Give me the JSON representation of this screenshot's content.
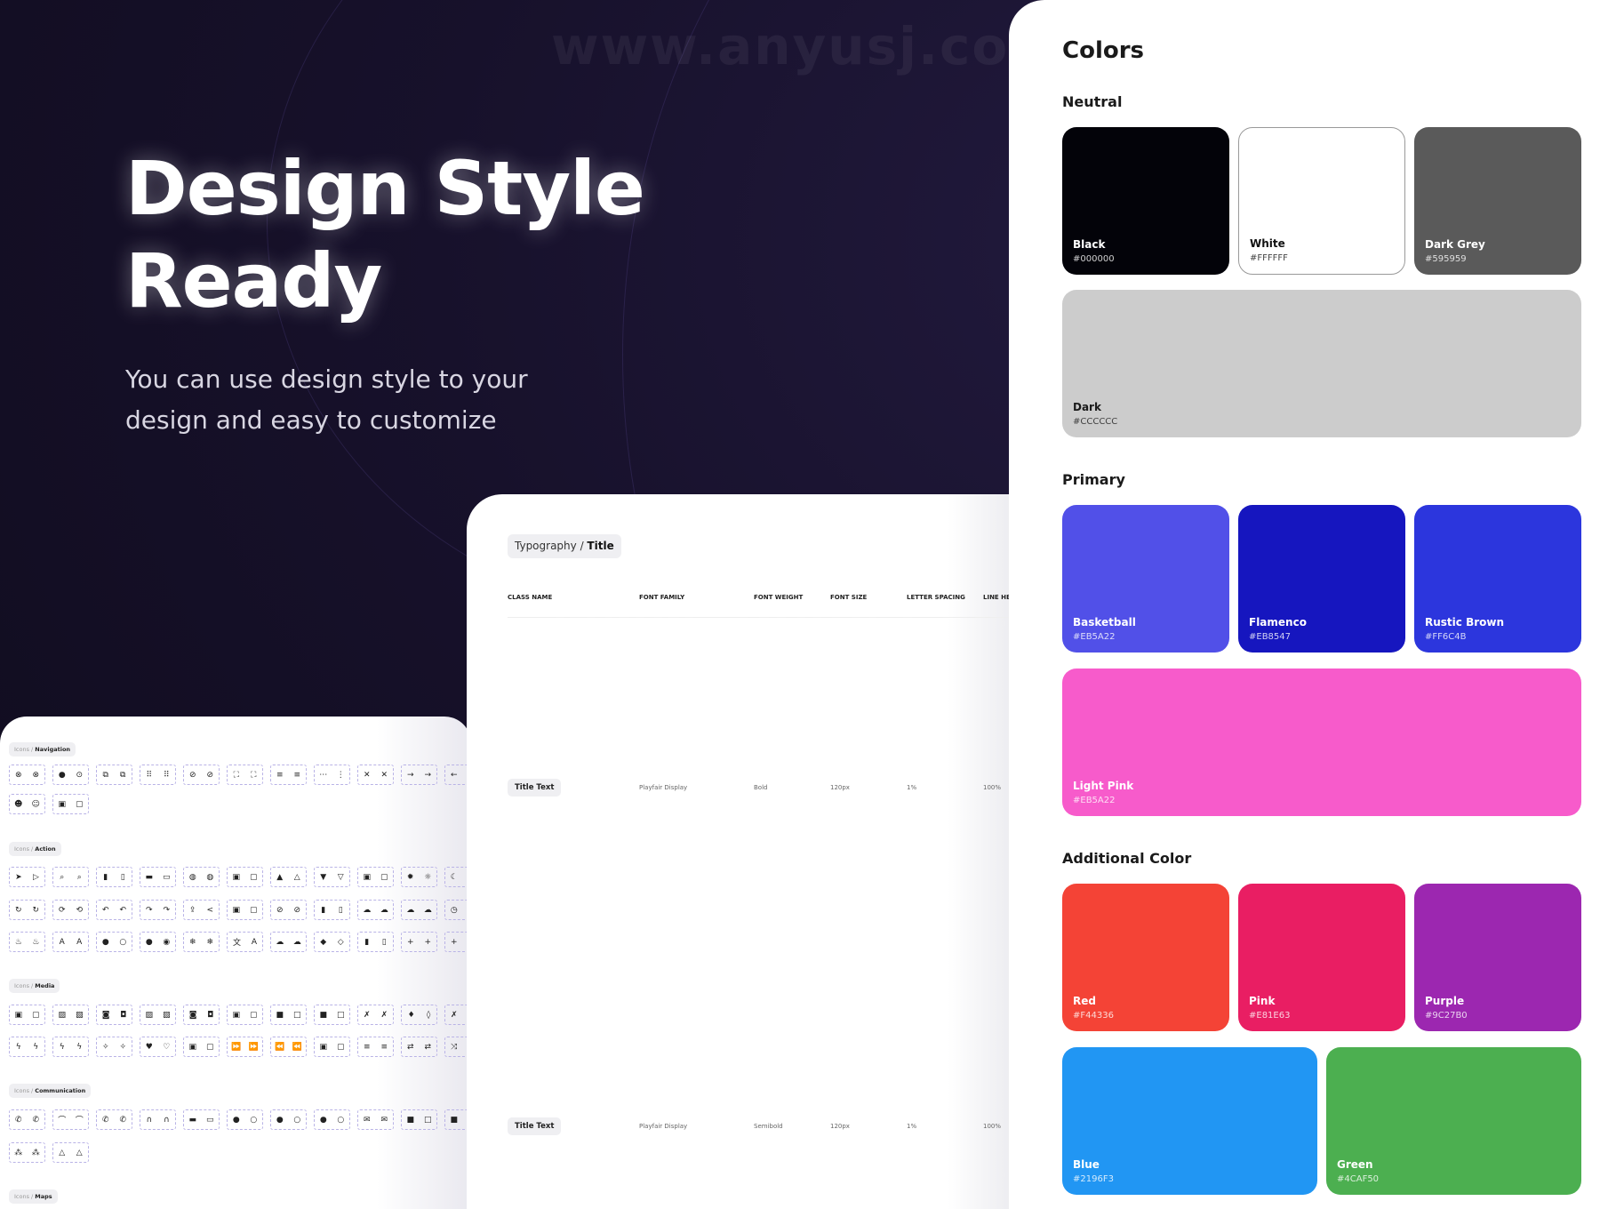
{
  "hero": {
    "title_line1": "Design Style",
    "title_line2": "Ready",
    "subtitle_line1": "You can use design style to your",
    "subtitle_line2": "design and easy to customize"
  },
  "watermark": "www.anyusj.com",
  "icons_panel": {
    "sections": [
      {
        "prefix": "Icons / ",
        "name": "Navigation",
        "rows": [
          [
            "close-circle",
            "chevron-circle",
            "external-link",
            "grid",
            "rotate",
            "fullscreen",
            "menu",
            "more",
            "close",
            "arrow-right",
            "arrow-left"
          ],
          [
            "emoji",
            "image-frame"
          ]
        ]
      },
      {
        "prefix": "Icons / ",
        "name": "Action",
        "rows": [
          [
            "send",
            "search",
            "trash",
            "monitor",
            "globe",
            "calendar",
            "thumb-up",
            "thumb-down",
            "screen-share",
            "sun",
            "moon"
          ],
          [
            "refresh",
            "sync",
            "undo",
            "redo",
            "share",
            "contact",
            "block",
            "file-add",
            "cloud-upload",
            "cloud-off",
            "clock"
          ],
          [
            "fire",
            "text-box",
            "drop",
            "info",
            "snowflake",
            "translate",
            "cloud-download",
            "leaf",
            "exit",
            "user-add",
            "group-add"
          ]
        ]
      },
      {
        "prefix": "Icons / ",
        "name": "Media",
        "rows": [
          [
            "image",
            "image-off",
            "camera",
            "camera-off",
            "camera-switch",
            "camera-roll",
            "video",
            "video-off",
            "mic-off",
            "mic",
            "volume-off"
          ],
          [
            "flash",
            "flash-off",
            "magic-wand",
            "heart",
            "subtitles",
            "fast-forward",
            "rewind",
            "picture-in-picture",
            "playlist-add",
            "repeat",
            "shuffle"
          ]
        ]
      },
      {
        "prefix": "Icons / ",
        "name": "Communication",
        "rows": [
          [
            "phone",
            "call-end",
            "call-add",
            "headset",
            "inbox",
            "apple",
            "whatsapp",
            "telegram",
            "mail",
            "chat-add",
            "chat"
          ],
          [
            "group",
            "contact-pin"
          ]
        ]
      },
      {
        "prefix": "Icons / ",
        "name": "Maps",
        "rows": []
      }
    ]
  },
  "typography": {
    "breadcrumb_prefix": "Typography / ",
    "breadcrumb_current": "Title",
    "columns": [
      "CLASS NAME",
      "FONT FAMILY",
      "FONT WEIGHT",
      "FONT SIZE",
      "LETTER SPACING",
      "LINE HEI"
    ],
    "rows": [
      {
        "class": "Title Text",
        "family": "Playfair Display",
        "weight": "Bold",
        "size": "120px",
        "spacing": "1%",
        "line": "100%"
      },
      {
        "class": "Title Text",
        "family": "Playfair Display",
        "weight": "Semibold",
        "size": "120px",
        "spacing": "1%",
        "line": "100%"
      }
    ]
  },
  "colors": {
    "title": "Colors",
    "neutral_label": "Neutral",
    "primary_label": "Primary",
    "additional_label": "Additional Color",
    "neutral": [
      {
        "name": "Black",
        "hex": "#000000",
        "fill": "#030309",
        "text": "#ffffff"
      },
      {
        "name": "White",
        "hex": "#FFFFFF",
        "fill": "#ffffff",
        "text": "#111111"
      },
      {
        "name": "Dark Grey",
        "hex": "#595959",
        "fill": "#5a5a5a",
        "text": "#ffffff"
      },
      {
        "name": "Dark",
        "hex": "#CCCCCC",
        "fill": "#cccccc",
        "text": "#1a1a1a"
      }
    ],
    "primary": [
      {
        "name": "Basketball",
        "hex": "#EB5A22",
        "fill": "#5150e8",
        "text": "#ffffff"
      },
      {
        "name": "Flamenco",
        "hex": "#EB8547",
        "fill": "#1616bf",
        "text": "#ffffff"
      },
      {
        "name": "Rustic Brown",
        "hex": "#FF6C4B",
        "fill": "#2c36dd",
        "text": "#ffffff"
      },
      {
        "name": "Light Pink",
        "hex": "#EB5A22",
        "fill": "#f75bcb",
        "text": "#ffffff"
      }
    ],
    "additional": [
      {
        "name": "Red",
        "hex": "#F44336",
        "fill": "#f44336",
        "text": "#ffffff"
      },
      {
        "name": "Pink",
        "hex": "#E81E63",
        "fill": "#e91e63",
        "text": "#ffffff"
      },
      {
        "name": "Purple",
        "hex": "#9C27B0",
        "fill": "#9c27b0",
        "text": "#ffffff"
      },
      {
        "name": "Blue",
        "hex": "#2196F3",
        "fill": "#2196f3",
        "text": "#ffffff"
      },
      {
        "name": "Green",
        "hex": "#4CAF50",
        "fill": "#4caf50",
        "text": "#ffffff"
      }
    ]
  }
}
